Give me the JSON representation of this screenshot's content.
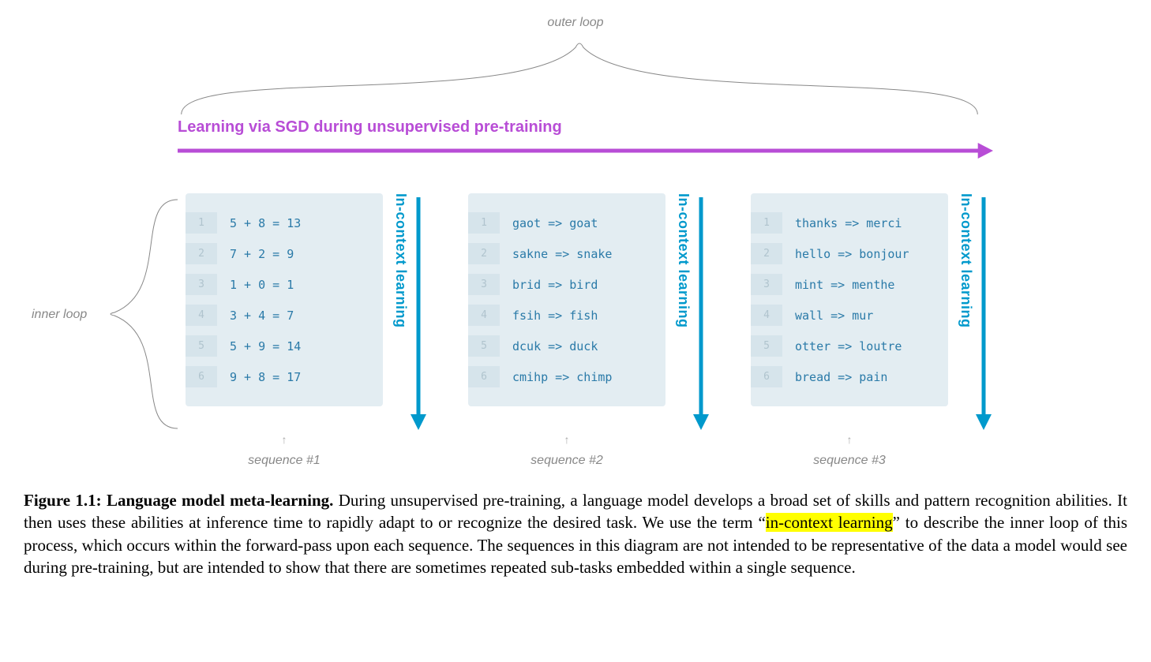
{
  "outer_loop_label": "outer loop",
  "sgd_label": "Learning via SGD during unsupervised pre-training",
  "inner_loop_label": "inner loop",
  "in_context_label": "In-context learning",
  "sequences": [
    {
      "caption": "sequence #1",
      "rows": [
        "5 + 8 = 13",
        "7 + 2 = 9",
        "1 + 0 = 1",
        "3 + 4 = 7",
        "5 + 9 = 14",
        "9 + 8 = 17"
      ]
    },
    {
      "caption": "sequence #2",
      "rows": [
        "gaot => goat",
        "sakne => snake",
        "brid => bird",
        "fsih => fish",
        "dcuk => duck",
        "cmihp => chimp"
      ]
    },
    {
      "caption": "sequence #3",
      "rows": [
        "thanks => merci",
        "hello => bonjour",
        "mint => menthe",
        "wall => mur",
        "otter => loutre",
        "bread => pain"
      ]
    }
  ],
  "caption": {
    "title": "Figure 1.1: Language model meta-learning.",
    "body_before_highlight": " During unsupervised pre-training, a language model develops a broad set of skills and pattern recognition abilities. It then uses these abilities at inference time to rapidly adapt to or recognize the desired task. We use the term “",
    "highlight": "in-context learning",
    "body_after_highlight": "” to describe the inner loop of this process, which occurs within the forward-pass upon each sequence. The sequences in this diagram are not intended to be representative of the data a model would see during pre-training, but are intended to show that there are sometimes repeated sub-tasks embedded within a single sequence."
  },
  "colors": {
    "purple": "#b84dd6",
    "blue": "#0099cc",
    "panel_bg": "#e3edf2",
    "code_text": "#2a7aa8",
    "highlight": "#ffff00"
  }
}
